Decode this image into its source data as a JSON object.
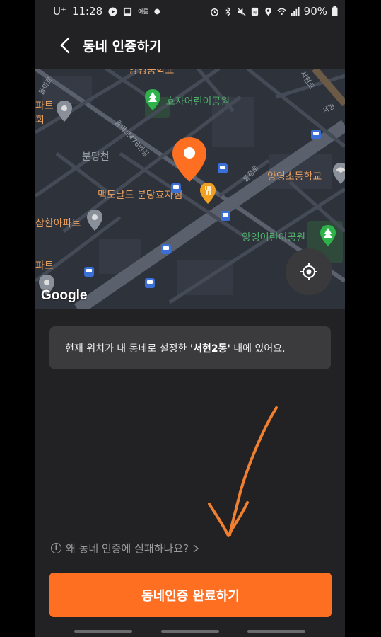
{
  "status_bar": {
    "carrier": "U⁺",
    "time": "11:28",
    "small_label": "여름",
    "battery": "90%"
  },
  "header": {
    "title": "동네 인증하기"
  },
  "map": {
    "labels": {
      "school_top": "양영중학교",
      "park1": "효자어린이공원",
      "apt1_a": "파트",
      "apt1_b": "회",
      "district": "분당천",
      "road1": "돌마로",
      "road2": "돌마로476번길",
      "road3": "불정로",
      "road4": "서현로",
      "road5": "서현",
      "mcdonalds": "맥도날드 분당효자점",
      "elem_school": "양영초등학교",
      "apt2": "삼환아파트",
      "park2": "양영어린이공원",
      "apt3": "파트"
    },
    "attribution": "Google"
  },
  "info": {
    "prefix": "현재 위치가 내 동네로 설정한 ",
    "highlight": "'서현2동'",
    "suffix": " 내에 있어요."
  },
  "help": {
    "label": "왜 동네 인증에 실패하나요?"
  },
  "primary_button": {
    "label": "동네인증 완료하기"
  },
  "colors": {
    "accent": "#fe6f22",
    "background": "#222224",
    "info_box": "#3b3b3d",
    "map_bg": "#2e323b"
  }
}
